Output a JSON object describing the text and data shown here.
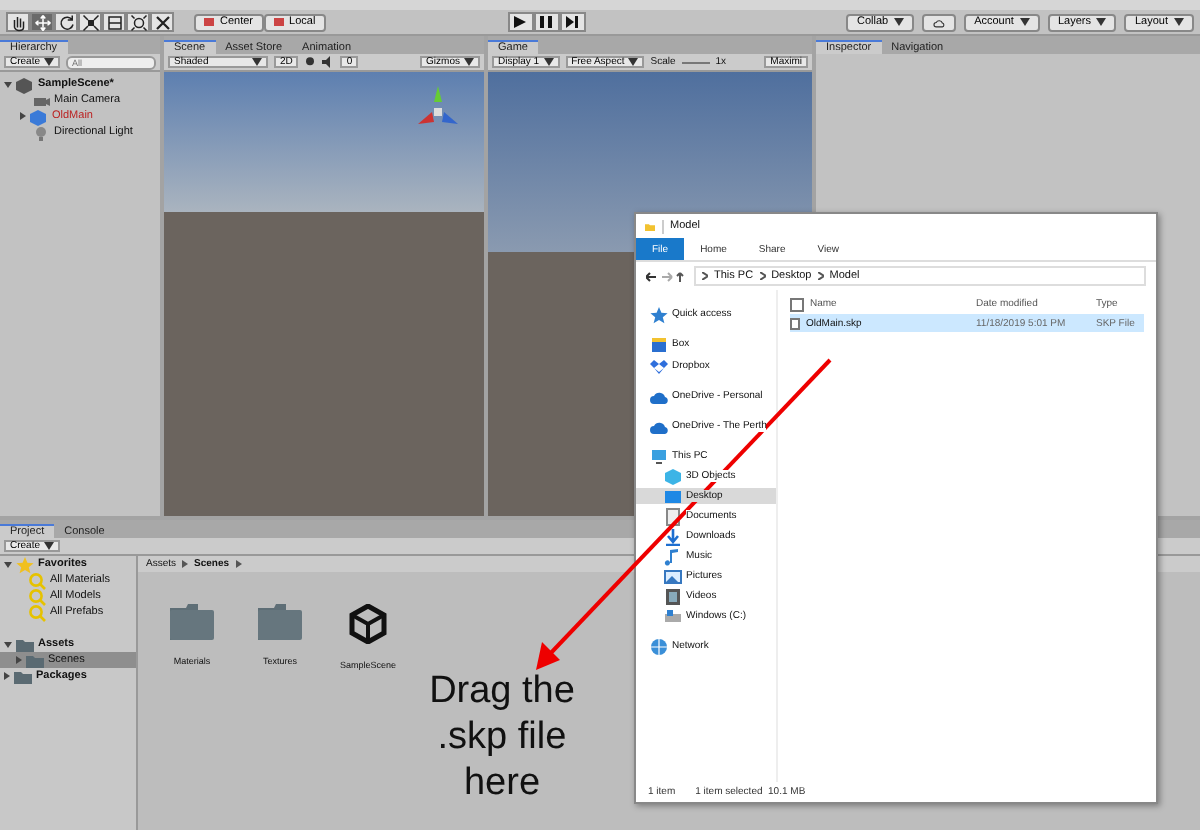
{
  "toolbar": {
    "tools": [
      {
        "kind": "hand",
        "selected": false
      },
      {
        "kind": "move",
        "selected": true
      },
      {
        "kind": "rotate",
        "selected": false
      },
      {
        "kind": "scale",
        "selected": false
      },
      {
        "kind": "rect",
        "selected": false
      },
      {
        "kind": "transform",
        "selected": false
      },
      {
        "kind": "custom",
        "selected": false
      }
    ],
    "pivot_buttons": [
      "Center",
      "Local"
    ],
    "right_buttons": [
      {
        "kind": "dropdown",
        "label": "Collab"
      },
      {
        "kind": "cloud"
      },
      {
        "kind": "dropdown",
        "label": "Account"
      },
      {
        "kind": "dropdown",
        "label": "Layers"
      },
      {
        "kind": "dropdown",
        "label": "Layout"
      }
    ]
  },
  "hierarchy": {
    "tab": "Hierarchy",
    "create": "Create",
    "search_placeholder": "All",
    "items": [
      {
        "label": "SampleScene*",
        "kind": "scene",
        "expanded": true,
        "children": [
          {
            "label": "Main Camera",
            "kind": "camera"
          },
          {
            "label": "OldMain",
            "kind": "model",
            "expanded": false,
            "missing": true
          },
          {
            "label": "Directional Light",
            "kind": "light"
          }
        ]
      }
    ]
  },
  "scene": {
    "tabs": [
      {
        "label": "Scene",
        "selected": true
      },
      {
        "label": "Asset Store",
        "selected": false
      },
      {
        "label": "Animation",
        "selected": false
      }
    ],
    "shading": "Shaded",
    "mode_2d": "2D",
    "fx_count": "0",
    "gizmos": "Gizmos"
  },
  "game": {
    "tabs": [
      {
        "label": "Game",
        "selected": true
      }
    ],
    "display": "Display 1",
    "aspect": "Free Aspect",
    "scale_label": "Scale",
    "scale_value": "1x",
    "maximize": "Maximi"
  },
  "inspector": {
    "tabs": [
      {
        "label": "Inspector",
        "selected": true
      },
      {
        "label": "Navigation",
        "selected": false
      }
    ]
  },
  "project": {
    "tabs": [
      {
        "label": "Project",
        "selected": true
      },
      {
        "label": "Console",
        "selected": false
      }
    ],
    "create": "Create",
    "tree": [
      {
        "label": "Favorites",
        "kind": "favorites",
        "expanded": true,
        "selected": false,
        "children": [
          {
            "label": "All Materials",
            "kind": "search",
            "selected": false
          },
          {
            "label": "All Models",
            "kind": "search",
            "selected": false
          },
          {
            "label": "All Prefabs",
            "kind": "search",
            "selected": false
          }
        ]
      },
      {
        "label": "Assets",
        "kind": "folder",
        "expanded": true,
        "selected": false,
        "children": [
          {
            "label": "Scenes",
            "kind": "folder",
            "expanded": false,
            "selected": true
          }
        ]
      },
      {
        "label": "Packages",
        "kind": "folder",
        "expanded": false,
        "selected": false
      }
    ],
    "breadcrumb": [
      "Assets",
      "Scenes"
    ],
    "assets": [
      {
        "label": "Materials",
        "kind": "folder"
      },
      {
        "label": "Textures",
        "kind": "folder"
      },
      {
        "label": "SampleScene",
        "kind": "scene"
      }
    ]
  },
  "explorer": {
    "title": "Model",
    "ribbon_tabs": [
      {
        "label": "File",
        "selected": true
      },
      {
        "label": "Home",
        "selected": false
      },
      {
        "label": "Share",
        "selected": false
      },
      {
        "label": "View",
        "selected": false
      }
    ],
    "path": [
      "This PC",
      "Desktop",
      "Model"
    ],
    "columns": [
      "Name",
      "Date modified",
      "Type"
    ],
    "select_all_checked": false,
    "nav": [
      {
        "label": "Quick access",
        "kind": "star",
        "selected": false
      },
      {
        "label": "Box",
        "kind": "box",
        "selected": false
      },
      {
        "label": "Dropbox",
        "kind": "dropbox",
        "selected": false
      },
      {
        "label": "OneDrive - Personal",
        "kind": "cloud",
        "selected": false
      },
      {
        "label": "OneDrive - The Perth",
        "kind": "cloud",
        "selected": false
      },
      {
        "label": "This PC",
        "kind": "pc",
        "selected": false,
        "children": [
          {
            "label": "3D Objects",
            "kind": "cube",
            "selected": false
          },
          {
            "label": "Desktop",
            "kind": "desktop",
            "selected": true
          },
          {
            "label": "Documents",
            "kind": "document",
            "selected": false
          },
          {
            "label": "Downloads",
            "kind": "download",
            "selected": false
          },
          {
            "label": "Music",
            "kind": "music",
            "selected": false
          },
          {
            "label": "Pictures",
            "kind": "picture",
            "selected": false
          },
          {
            "label": "Videos",
            "kind": "video",
            "selected": false
          },
          {
            "label": "Windows (C:)",
            "kind": "drive",
            "selected": false
          }
        ]
      },
      {
        "label": "Network",
        "kind": "network",
        "selected": false
      }
    ],
    "files": [
      {
        "name": "OldMain.skp",
        "date": "11/18/2019 5:01 PM",
        "type": "SKP File",
        "selected": true
      }
    ],
    "status": [
      "1 item",
      "1 item selected  10.1 MB"
    ]
  },
  "annotation": {
    "text": "Drag the .skp file here"
  }
}
